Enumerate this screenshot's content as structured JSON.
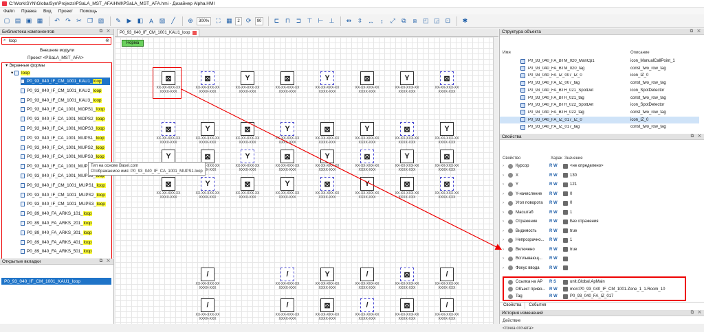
{
  "window": {
    "title": "C:\\Work\\SYN\\GlobalSyn\\Projects\\PSaLA_MST_AFA\\HMI\\PSaLA_MST_AFA.hmi - Дизайнер Alpha.HMI"
  },
  "menu": [
    "Файл",
    "Правка",
    "Вид",
    "Проект",
    "Помощь"
  ],
  "toolbar": {
    "zoom": "300%",
    "spin1": "2",
    "spin2": "90"
  },
  "left": {
    "library_title": "Библиотека компонентов",
    "search_value": "loop",
    "external_modules": "Внешние модули",
    "project": "Проект <PSaLA_MST_AFA>",
    "screen_forms": "Экранные формы",
    "loop_folder": "loop",
    "items": [
      {
        "prefix": "P0_93_040_IF_CM_1001_KAU1",
        "hl": "loop"
      },
      {
        "prefix": "P0_93_040_IF_CM_1001_KAU2",
        "hl": "loop"
      },
      {
        "prefix": "P0_93_040_IF_CM_1001_KAU3",
        "hl": "loop"
      },
      {
        "prefix": "P0_93_040_IF_CA_1001_MOPS1",
        "hl": "loop"
      },
      {
        "prefix": "P0_93_040_IF_CA_1001_MOPS2",
        "hl": "loop"
      },
      {
        "prefix": "P0_93_040_IF_CA_1001_MOPS3",
        "hl": "loop"
      },
      {
        "prefix": "P0_93_040_IF_CA_1001_MUPS1",
        "hl": "loop"
      },
      {
        "prefix": "P0_93_040_IF_CA_1001_MUPS2",
        "hl": "loop"
      },
      {
        "prefix": "P0_93_040_IF_CA_1001_MUPS3",
        "hl": "loop"
      },
      {
        "prefix": "P0_93_040_IF_CA_1001_MUPS4",
        "hl": "loop"
      },
      {
        "prefix": "P0_93_040_IF_CA_1001_MUPS5",
        "hl": "loop"
      },
      {
        "prefix": "P0_93_040_IF_CM_1001_MUPS1",
        "hl": "loop"
      },
      {
        "prefix": "P0_93_040_IF_CM_1001_MUPS2",
        "hl": "loop"
      },
      {
        "prefix": "P0_93_040_IF_CM_1001_MUPS3",
        "hl": "loop"
      },
      {
        "prefix": "P0_89_040_FA_ARKS_101",
        "hl": "loop"
      },
      {
        "prefix": "P0_89_040_FA_ARKS_201",
        "hl": "loop"
      },
      {
        "prefix": "P0_89_040_FA_ARKS_301",
        "hl": "loop"
      },
      {
        "prefix": "P0_89_040_FA_ARKS_401",
        "hl": "loop"
      },
      {
        "prefix": "P0_89_040_FA_ARKS_501",
        "hl": "loop"
      }
    ],
    "tooltip": {
      "line1": "Тип на основе Basel.com",
      "line2": "Отображаемое имя: P0_93_040_IF_CA_1001_MUPS1.loop"
    },
    "bookmarks_title": "Открытые вкладки",
    "bookmark_item": "P0_93_040_IF_CM_1001_KAU1_loop"
  },
  "center": {
    "tab": "P0_93_040_IF_CM_1001_KAU1_loop",
    "norm_button": "Норма",
    "cell_label": "XX-XX-XXX-XX\nXXXX-XXX"
  },
  "structure": {
    "title": "Структура объекта",
    "col_name": "Имя",
    "col_desc": "Описание",
    "rows": [
      {
        "name": "P0_93_040_FA_BTM_020_ManCp1",
        "desc": "icon_ManualCallPoint_1"
      },
      {
        "name": "P0_93_040_FA_BTM_020_tag",
        "desc": "const_two_row_tag"
      },
      {
        "name": "P0_93_040_FA_IZ_007_IZ_0",
        "desc": "icon_IZ_0"
      },
      {
        "name": "P0_93_040_FA_IZ_007_tag",
        "desc": "const_two_row_tag"
      },
      {
        "name": "P0_93_040_FA_BTH_021_SpotDet",
        "desc": "icon_SpotDetector"
      },
      {
        "name": "P0_93_040_FA_BTH_021_tag",
        "desc": "const_two_row_tag"
      },
      {
        "name": "P0_93_040_FA_BTH_022_SpotDet",
        "desc": "icon_SpotDetector"
      },
      {
        "name": "P0_93_040_FA_BTH_022_tag",
        "desc": "const_two_row_tag"
      },
      {
        "name": "P0_93_040_FA_IZ_017_IZ_0",
        "desc": "icon_IZ_0"
      },
      {
        "name": "P0_93_040_FA_IZ_017_tag",
        "desc": "const_two_row_tag"
      }
    ]
  },
  "properties": {
    "title": "Свойства",
    "col_prop": "Свойство",
    "col_char": "Харак",
    "col_val": "Значение",
    "rows": [
      {
        "name": "Курсор",
        "flags": "R W",
        "value": "<не определено>"
      },
      {
        "name": "X",
        "flags": "R W",
        "value": "130"
      },
      {
        "name": "Y",
        "flags": "R W",
        "value": "121"
      },
      {
        "name": "Y-начисление",
        "flags": "R W",
        "value": "0"
      },
      {
        "name": "Угол поворота",
        "flags": "R W",
        "value": "0"
      },
      {
        "name": "Масштаб",
        "flags": "R W",
        "value": "1"
      },
      {
        "name": "Отражение",
        "flags": "R W",
        "value": "Без отражения"
      },
      {
        "name": "Видимость",
        "flags": "R W",
        "value": "true"
      },
      {
        "name": "Непрозрачно...",
        "flags": "R W",
        "value": "1"
      },
      {
        "name": "Включено",
        "flags": "R W",
        "value": "true"
      },
      {
        "name": "Всплывающ...",
        "flags": "R W",
        "value": ""
      },
      {
        "name": "Фокус ввода",
        "flags": "R W",
        "value": ""
      }
    ],
    "boxed": [
      {
        "name": "Ссылка на АР",
        "flags": "R S",
        "value": "unit.Global.ApMain"
      },
      {
        "name": "Объект приво...",
        "flags": "R W",
        "value": "mon:P0_93_040_IF_CM_1001.Zone_1_1.Room_10"
      },
      {
        "name": "Tag",
        "flags": "R W",
        "value": "P0_93_040_FA_IZ_017"
      }
    ],
    "subtab1": "Свойства",
    "subtab2": "События"
  },
  "history": {
    "title": "История изменений",
    "col": "Действие",
    "item": "<точка отсчета>"
  },
  "colors": {
    "accent": "#1f74c8",
    "highlight": "#ffff3a",
    "annotation": "#e00000",
    "norm": "#6ad15d"
  }
}
